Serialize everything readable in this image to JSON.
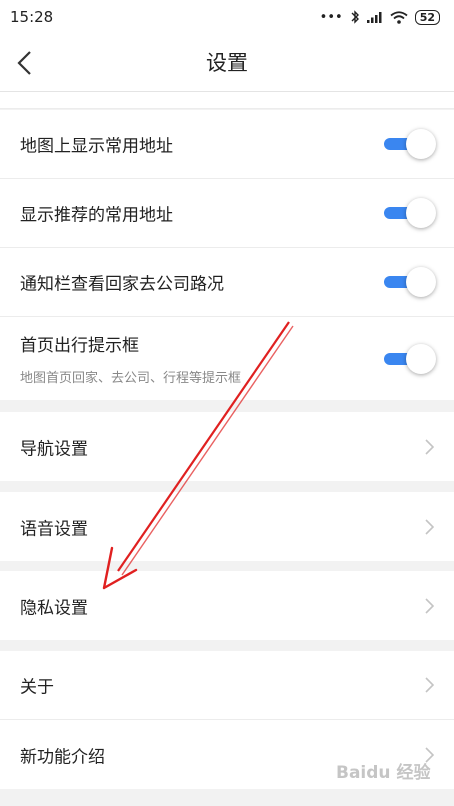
{
  "status_bar": {
    "time": "15:28",
    "dots": "•••",
    "battery": "52"
  },
  "header": {
    "title": "设置",
    "back_icon": "chevron-left-icon"
  },
  "partial_row_text": "",
  "toggle_items": [
    {
      "label": "地图上显示常用地址",
      "enabled": true
    },
    {
      "label": "显示推荐的常用地址",
      "enabled": true
    },
    {
      "label": "通知栏查看回家去公司路况",
      "enabled": true
    },
    {
      "label": "首页出行提示框",
      "sublabel": "地图首页回家、去公司、行程等提示框",
      "enabled": true
    }
  ],
  "nav_items": [
    {
      "label": "导航设置"
    },
    {
      "label": "语音设置"
    },
    {
      "label": "隐私设置"
    },
    {
      "label": "关于"
    },
    {
      "label": "新功能介绍"
    }
  ],
  "watermark": "Baidu 经验",
  "colors": {
    "accent": "#3a86f0",
    "annotation": "#e02020",
    "background": "#f2f2f2"
  }
}
